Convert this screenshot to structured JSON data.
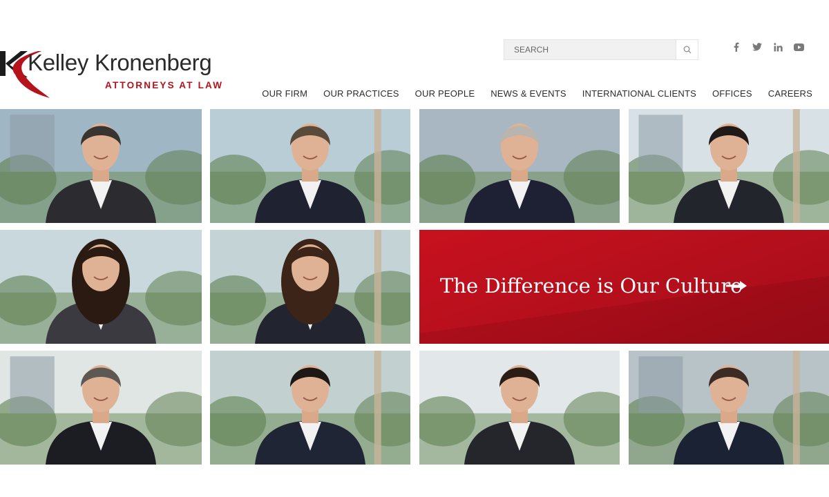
{
  "brand": {
    "name": "Kelley Kronenberg",
    "tagline": "ATTORNEYS AT LAW",
    "accent_color": "#b5121b"
  },
  "search": {
    "placeholder": "SEARCH",
    "icon": "search-icon"
  },
  "social": [
    {
      "name": "facebook-icon",
      "glyph": "f"
    },
    {
      "name": "twitter-icon",
      "glyph": "t"
    },
    {
      "name": "linkedin-icon",
      "glyph": "in"
    },
    {
      "name": "youtube-icon",
      "glyph": "play"
    }
  ],
  "nav": {
    "items": [
      {
        "label": "OUR FIRM"
      },
      {
        "label": "OUR PRACTICES"
      },
      {
        "label": "OUR PEOPLE"
      },
      {
        "label": "NEWS & EVENTS"
      },
      {
        "label": "INTERNATIONAL CLIENTS"
      },
      {
        "label": "OFFICES"
      },
      {
        "label": "CAREERS"
      }
    ]
  },
  "culture_banner": {
    "text": "The Difference is Our Culture",
    "icon": "arrow-right-icon",
    "background": "#b8101d"
  },
  "people_tiles": [
    {
      "name": "attorney-photo-1",
      "hair": "#3a3430",
      "suit": "#2b2b30",
      "bg": "#9fb7c4"
    },
    {
      "name": "attorney-photo-2",
      "hair": "#5a4a3a",
      "suit": "#1f2230",
      "bg": "#b9cdd6"
    },
    {
      "name": "attorney-photo-3",
      "hair": "#b8b4ae",
      "suit": "#1d2133",
      "bg": "#a8b7c1"
    },
    {
      "name": "attorney-photo-4",
      "hair": "#1f1a17",
      "suit": "#23252c",
      "bg": "#d8e2e6"
    },
    {
      "name": "attorney-photo-5",
      "hair": "#2a1a12",
      "suit": "#3a3a40",
      "bg": "#c9d8dc"
    },
    {
      "name": "attorney-photo-6",
      "hair": "#3d2418",
      "suit": "#222430",
      "bg": "#c3d3d6"
    },
    {
      "name": "attorney-photo-7",
      "hair": "#5d5854",
      "suit": "#1c1d22",
      "bg": "#dfe6e4"
    },
    {
      "name": "attorney-photo-8",
      "hair": "#1d1815",
      "suit": "#1f2535",
      "bg": "#c2d1cf"
    },
    {
      "name": "attorney-photo-9",
      "hair": "#2a1d15",
      "suit": "#25262c",
      "bg": "#e2e8ea"
    },
    {
      "name": "attorney-photo-10",
      "hair": "#3a2c24",
      "suit": "#1b2234",
      "bg": "#b8c3c8"
    }
  ]
}
